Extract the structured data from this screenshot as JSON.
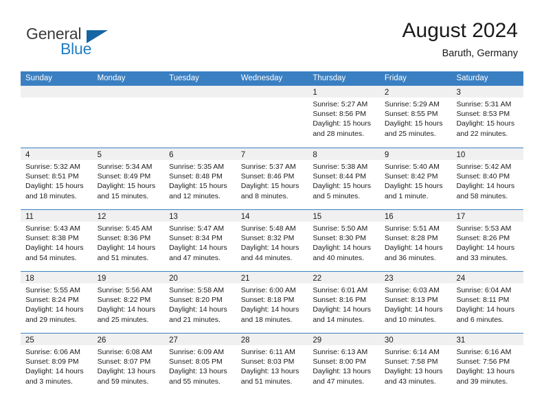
{
  "brand": {
    "name_top": "General",
    "name_bottom": "Blue",
    "triangle_color": "#1565a4",
    "blue_color": "#1f7dc4"
  },
  "header": {
    "title": "August 2024",
    "subtitle": "Baruth, Germany"
  },
  "theme": {
    "header_blue": "#3a7fc1",
    "daynum_strip": "#f0f0f0",
    "text": "#1a1a1a"
  },
  "weekdays": [
    "Sunday",
    "Monday",
    "Tuesday",
    "Wednesday",
    "Thursday",
    "Friday",
    "Saturday"
  ],
  "weeks": [
    [
      {
        "day": "",
        "sunrise": "",
        "sunset": "",
        "daylight": "",
        "empty": true
      },
      {
        "day": "",
        "sunrise": "",
        "sunset": "",
        "daylight": "",
        "empty": true
      },
      {
        "day": "",
        "sunrise": "",
        "sunset": "",
        "daylight": "",
        "empty": true
      },
      {
        "day": "",
        "sunrise": "",
        "sunset": "",
        "daylight": "",
        "empty": true
      },
      {
        "day": "1",
        "sunrise": "Sunrise: 5:27 AM",
        "sunset": "Sunset: 8:56 PM",
        "daylight": "Daylight: 15 hours and 28 minutes."
      },
      {
        "day": "2",
        "sunrise": "Sunrise: 5:29 AM",
        "sunset": "Sunset: 8:55 PM",
        "daylight": "Daylight: 15 hours and 25 minutes."
      },
      {
        "day": "3",
        "sunrise": "Sunrise: 5:31 AM",
        "sunset": "Sunset: 8:53 PM",
        "daylight": "Daylight: 15 hours and 22 minutes."
      }
    ],
    [
      {
        "day": "4",
        "sunrise": "Sunrise: 5:32 AM",
        "sunset": "Sunset: 8:51 PM",
        "daylight": "Daylight: 15 hours and 18 minutes."
      },
      {
        "day": "5",
        "sunrise": "Sunrise: 5:34 AM",
        "sunset": "Sunset: 8:49 PM",
        "daylight": "Daylight: 15 hours and 15 minutes."
      },
      {
        "day": "6",
        "sunrise": "Sunrise: 5:35 AM",
        "sunset": "Sunset: 8:48 PM",
        "daylight": "Daylight: 15 hours and 12 minutes."
      },
      {
        "day": "7",
        "sunrise": "Sunrise: 5:37 AM",
        "sunset": "Sunset: 8:46 PM",
        "daylight": "Daylight: 15 hours and 8 minutes."
      },
      {
        "day": "8",
        "sunrise": "Sunrise: 5:38 AM",
        "sunset": "Sunset: 8:44 PM",
        "daylight": "Daylight: 15 hours and 5 minutes."
      },
      {
        "day": "9",
        "sunrise": "Sunrise: 5:40 AM",
        "sunset": "Sunset: 8:42 PM",
        "daylight": "Daylight: 15 hours and 1 minute."
      },
      {
        "day": "10",
        "sunrise": "Sunrise: 5:42 AM",
        "sunset": "Sunset: 8:40 PM",
        "daylight": "Daylight: 14 hours and 58 minutes."
      }
    ],
    [
      {
        "day": "11",
        "sunrise": "Sunrise: 5:43 AM",
        "sunset": "Sunset: 8:38 PM",
        "daylight": "Daylight: 14 hours and 54 minutes."
      },
      {
        "day": "12",
        "sunrise": "Sunrise: 5:45 AM",
        "sunset": "Sunset: 8:36 PM",
        "daylight": "Daylight: 14 hours and 51 minutes."
      },
      {
        "day": "13",
        "sunrise": "Sunrise: 5:47 AM",
        "sunset": "Sunset: 8:34 PM",
        "daylight": "Daylight: 14 hours and 47 minutes."
      },
      {
        "day": "14",
        "sunrise": "Sunrise: 5:48 AM",
        "sunset": "Sunset: 8:32 PM",
        "daylight": "Daylight: 14 hours and 44 minutes."
      },
      {
        "day": "15",
        "sunrise": "Sunrise: 5:50 AM",
        "sunset": "Sunset: 8:30 PM",
        "daylight": "Daylight: 14 hours and 40 minutes."
      },
      {
        "day": "16",
        "sunrise": "Sunrise: 5:51 AM",
        "sunset": "Sunset: 8:28 PM",
        "daylight": "Daylight: 14 hours and 36 minutes."
      },
      {
        "day": "17",
        "sunrise": "Sunrise: 5:53 AM",
        "sunset": "Sunset: 8:26 PM",
        "daylight": "Daylight: 14 hours and 33 minutes."
      }
    ],
    [
      {
        "day": "18",
        "sunrise": "Sunrise: 5:55 AM",
        "sunset": "Sunset: 8:24 PM",
        "daylight": "Daylight: 14 hours and 29 minutes."
      },
      {
        "day": "19",
        "sunrise": "Sunrise: 5:56 AM",
        "sunset": "Sunset: 8:22 PM",
        "daylight": "Daylight: 14 hours and 25 minutes."
      },
      {
        "day": "20",
        "sunrise": "Sunrise: 5:58 AM",
        "sunset": "Sunset: 8:20 PM",
        "daylight": "Daylight: 14 hours and 21 minutes."
      },
      {
        "day": "21",
        "sunrise": "Sunrise: 6:00 AM",
        "sunset": "Sunset: 8:18 PM",
        "daylight": "Daylight: 14 hours and 18 minutes."
      },
      {
        "day": "22",
        "sunrise": "Sunrise: 6:01 AM",
        "sunset": "Sunset: 8:16 PM",
        "daylight": "Daylight: 14 hours and 14 minutes."
      },
      {
        "day": "23",
        "sunrise": "Sunrise: 6:03 AM",
        "sunset": "Sunset: 8:13 PM",
        "daylight": "Daylight: 14 hours and 10 minutes."
      },
      {
        "day": "24",
        "sunrise": "Sunrise: 6:04 AM",
        "sunset": "Sunset: 8:11 PM",
        "daylight": "Daylight: 14 hours and 6 minutes."
      }
    ],
    [
      {
        "day": "25",
        "sunrise": "Sunrise: 6:06 AM",
        "sunset": "Sunset: 8:09 PM",
        "daylight": "Daylight: 14 hours and 3 minutes."
      },
      {
        "day": "26",
        "sunrise": "Sunrise: 6:08 AM",
        "sunset": "Sunset: 8:07 PM",
        "daylight": "Daylight: 13 hours and 59 minutes."
      },
      {
        "day": "27",
        "sunrise": "Sunrise: 6:09 AM",
        "sunset": "Sunset: 8:05 PM",
        "daylight": "Daylight: 13 hours and 55 minutes."
      },
      {
        "day": "28",
        "sunrise": "Sunrise: 6:11 AM",
        "sunset": "Sunset: 8:03 PM",
        "daylight": "Daylight: 13 hours and 51 minutes."
      },
      {
        "day": "29",
        "sunrise": "Sunrise: 6:13 AM",
        "sunset": "Sunset: 8:00 PM",
        "daylight": "Daylight: 13 hours and 47 minutes."
      },
      {
        "day": "30",
        "sunrise": "Sunrise: 6:14 AM",
        "sunset": "Sunset: 7:58 PM",
        "daylight": "Daylight: 13 hours and 43 minutes."
      },
      {
        "day": "31",
        "sunrise": "Sunrise: 6:16 AM",
        "sunset": "Sunset: 7:56 PM",
        "daylight": "Daylight: 13 hours and 39 minutes."
      }
    ]
  ]
}
